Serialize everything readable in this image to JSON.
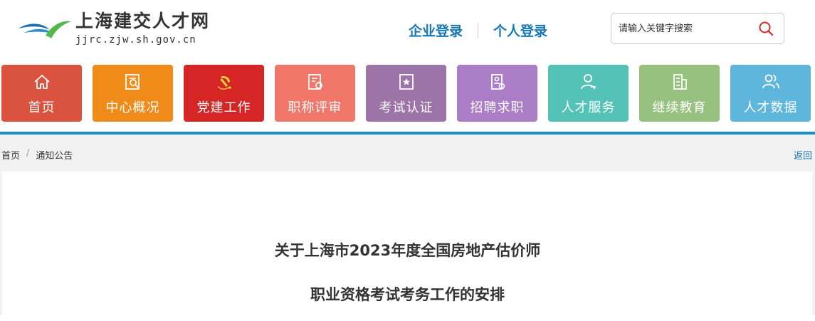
{
  "site": {
    "title": "上海建交人才网",
    "url": "jjrc.zjw.sh.gov.cn"
  },
  "login": {
    "enterprise": "企业登录",
    "personal": "个人登录"
  },
  "search": {
    "placeholder": "请输入关键字搜索"
  },
  "nav": [
    {
      "label": "首页",
      "color": "#d9533f",
      "icon": "home-icon"
    },
    {
      "label": "中心概况",
      "color": "#f08a19",
      "icon": "document-search-icon"
    },
    {
      "label": "党建工作",
      "color": "#d52525",
      "icon": "party-emblem-icon"
    },
    {
      "label": "职称评审",
      "color": "#f2776b",
      "icon": "certificate-icon"
    },
    {
      "label": "考试认证",
      "color": "#9c74a8",
      "icon": "bookmark-star-icon"
    },
    {
      "label": "招聘求职",
      "color": "#ab7dc6",
      "icon": "resume-icon"
    },
    {
      "label": "人才服务",
      "color": "#55c2b8",
      "icon": "user-service-icon"
    },
    {
      "label": "继续教育",
      "color": "#97c17e",
      "icon": "building-icon"
    },
    {
      "label": "人才数据",
      "color": "#5fb6dd",
      "icon": "users-icon"
    }
  ],
  "breadcrumb": {
    "home": "首页",
    "current": "通知公告",
    "back": "返回"
  },
  "article": {
    "title_line1": "关于上海市2023年度全国房地产估价师",
    "title_line2": "职业资格考试考务工作的安排"
  }
}
